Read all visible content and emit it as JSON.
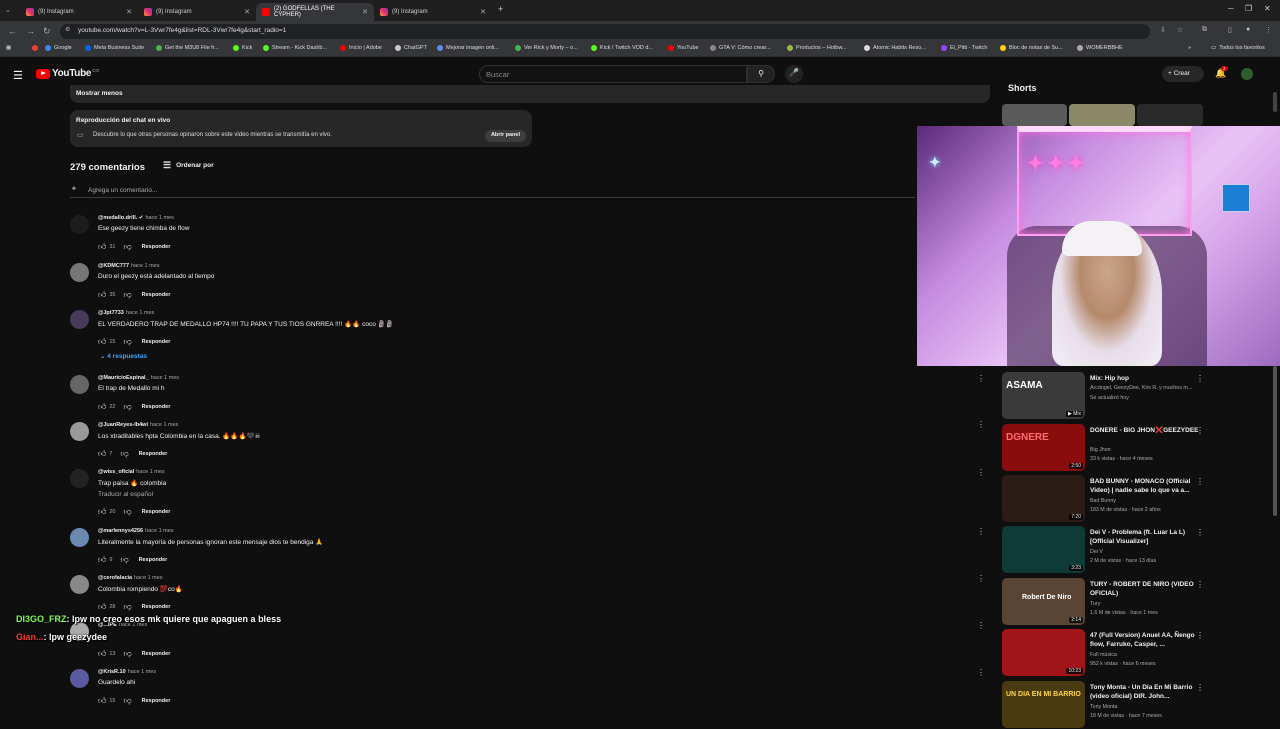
{
  "browser": {
    "tabs": [
      {
        "label": "(9) Instagram",
        "type": "ig"
      },
      {
        "label": "(9) Instagram",
        "type": "ig"
      },
      {
        "label": "(2) GODFELLAS (THE CYPHER)",
        "type": "yt",
        "active": true
      },
      {
        "label": "(9) Instagram",
        "type": "ig"
      }
    ],
    "url": "youtube.com/watch?v=L-3Vwr7fe4g&list=RDL-3Vwr7fe4g&start_radio=1",
    "bookmarks": [
      "Google",
      "Meta Business Suite",
      "Get the M3U8 File fr...",
      "Kick",
      "Stream - Kick Dashb...",
      "Inicio | Adobe",
      "ChatGPT",
      "Mejorar imagen onli...",
      "Ver Rick y Morty – o...",
      "Kick / Twitch VOD d...",
      "YouTube",
      "GTA V: Cómo crear...",
      "Productos – Hotbw...",
      "Atomic Habits Reso...",
      "El_Pitti - Twitch",
      "Bloc de notas de Su...",
      "WOMERBBHE"
    ],
    "bookmarks_right": "Todos los favoritos"
  },
  "youtube": {
    "logo_text": "YouTube",
    "logo_country": "CO",
    "search_placeholder": "Buscar",
    "create_label": "Crear",
    "notif_count": "2"
  },
  "description": {
    "show_less": "Mostrar menos"
  },
  "chat_replay": {
    "title": "Reproducción del chat en vivo",
    "desc": "Descubre lo que otras personas opinaron sobre este video mientras se transmitía en vivo.",
    "button": "Abrir panel"
  },
  "comments_header": {
    "count": "279 comentarios",
    "sort": "Ordenar por",
    "add_placeholder": "Agrega un comentario..."
  },
  "comments": [
    {
      "author": "@medallo.drill.",
      "verified": "✔",
      "time": "hace 1 mes",
      "text": "Ese geezy tiene chimba de flow",
      "likes": "31",
      "reply": "Responder"
    },
    {
      "author": "@KDMC777",
      "time": "hace 1 mes",
      "text": "Duro el geezy está adelantado al tiempo",
      "likes": "35",
      "reply": "Responder"
    },
    {
      "author": "@Jpt7733",
      "time": "hace 1 mes",
      "text": "EL VERDADERO TRAP DE MEDALLO HP74 !!!! TU PAPA Y TUS TIOS GNRREA !!!! 🔥🔥 coco 🗿🗿",
      "likes": "15",
      "reply": "Responder"
    },
    {
      "author": "@MauricioEspinal_",
      "time": "hace 1 mes",
      "text": "El trap de Medallo mi h",
      "likes": "22",
      "reply": "Responder"
    },
    {
      "author": "@JuanReyes-lb4wi",
      "time": "hace 1 mes",
      "text": "Los xtraditables hpta Colombia en la casa. 🔥🔥🔥🖤☠",
      "likes": "7",
      "reply": "Responder"
    },
    {
      "author": "@wiss_oficial",
      "time": "hace 1 mes",
      "text": "Trap paisa 🔥 colombia",
      "translate": "Traducir al español",
      "likes": "20",
      "reply": "Responder"
    },
    {
      "author": "@marlennys4256",
      "time": "hace 1 mes",
      "text": "Literalmente la mayoría de personas ignoran este mensaje dios te bendiga 🙏",
      "likes": "9",
      "reply": "Responder"
    },
    {
      "author": "@cerofalacia",
      "time": "hace 1 mes",
      "text": "Colombia rompiendo 💯co🔥",
      "likes": "28",
      "reply": "Responder"
    },
    {
      "author": "@...IPE",
      "time": "hace 1 mes",
      "text": "...",
      "likes": "13",
      "reply": "Responder"
    },
    {
      "author": "@KrisR.10",
      "time": "hace 1 mes",
      "text": "Guardelo ahi",
      "likes": "15",
      "reply": "Responder"
    }
  ],
  "replies_toggle": "4 respuestas",
  "stream_overlay": [
    {
      "user": "DI3GO_FRZ",
      "msg": ": lpw no creo esos mk quiere que apaguen a bless",
      "color": "#7fff4f"
    },
    {
      "user": "Gian...",
      "msg": ": lpw geezydee",
      "color": "#ff3a3a"
    }
  ],
  "sidebar": {
    "shorts_label": "Shorts",
    "recommendations": [
      {
        "title": "Mix: Hip hop",
        "channel": "Arcángel, GeezyDee, Kris R. y muchos m...",
        "meta": "Se actualizó hoy",
        "badge": "Mix",
        "thumb_text": "ASAMA",
        "thumb_color": "#3a3a3a"
      },
      {
        "title": "DGNERE - BIG JHON❌GEEZYDEE",
        "channel": "Big Jhon",
        "meta": "33 k vistas · hace 4 meses",
        "badge": "2:50",
        "thumb_text": "DGNERE",
        "thumb_color": "#8a0d0d"
      },
      {
        "title": "BAD BUNNY - MONACO (Official Video) | nadie sabe lo que va a...",
        "channel": "Bad Bunny",
        "meta": "183 M de vistas · hace 2 años",
        "badge": "7:20",
        "thumb_text": "",
        "thumb_color": "#2b1d16"
      },
      {
        "title": "Dei V - Problema (ft. Luar La L) [Official Visualizer]",
        "channel": "Dei V",
        "meta": "2 M de vistas · hace 13 días",
        "badge": "3:23",
        "thumb_text": "",
        "thumb_color": "#0f3b37"
      },
      {
        "title": "TURY - ROBERT DE NIRO (VIDEO OFICIAL)",
        "channel": "Tury",
        "meta": "1.6 M de vistas · hace 1 mes",
        "badge": "2:14",
        "thumb_text": "Robert De Niro",
        "thumb_color": "#5a4535"
      },
      {
        "title": "47 (Full Version) Anuel AA, Ñengo flow, Farruko, Casper, ...",
        "channel": "Full música",
        "meta": "952 k vistas · hace 6 meses",
        "badge": "10:23",
        "thumb_text": "",
        "thumb_color": "#a0141a"
      },
      {
        "title": "Tony Monta - Un Dia En Mi Barrio (video oficial) DIR. John...",
        "channel": "Tony Monta",
        "meta": "18 M de vistas · hace 7 meses",
        "badge": "",
        "thumb_text": "UN DIA EN MI BARRIO",
        "thumb_color": "#4a3a10"
      }
    ]
  },
  "colors": {
    "bg": "#0f0f0f",
    "accent": "#ff0000",
    "link": "#3ea6ff"
  }
}
